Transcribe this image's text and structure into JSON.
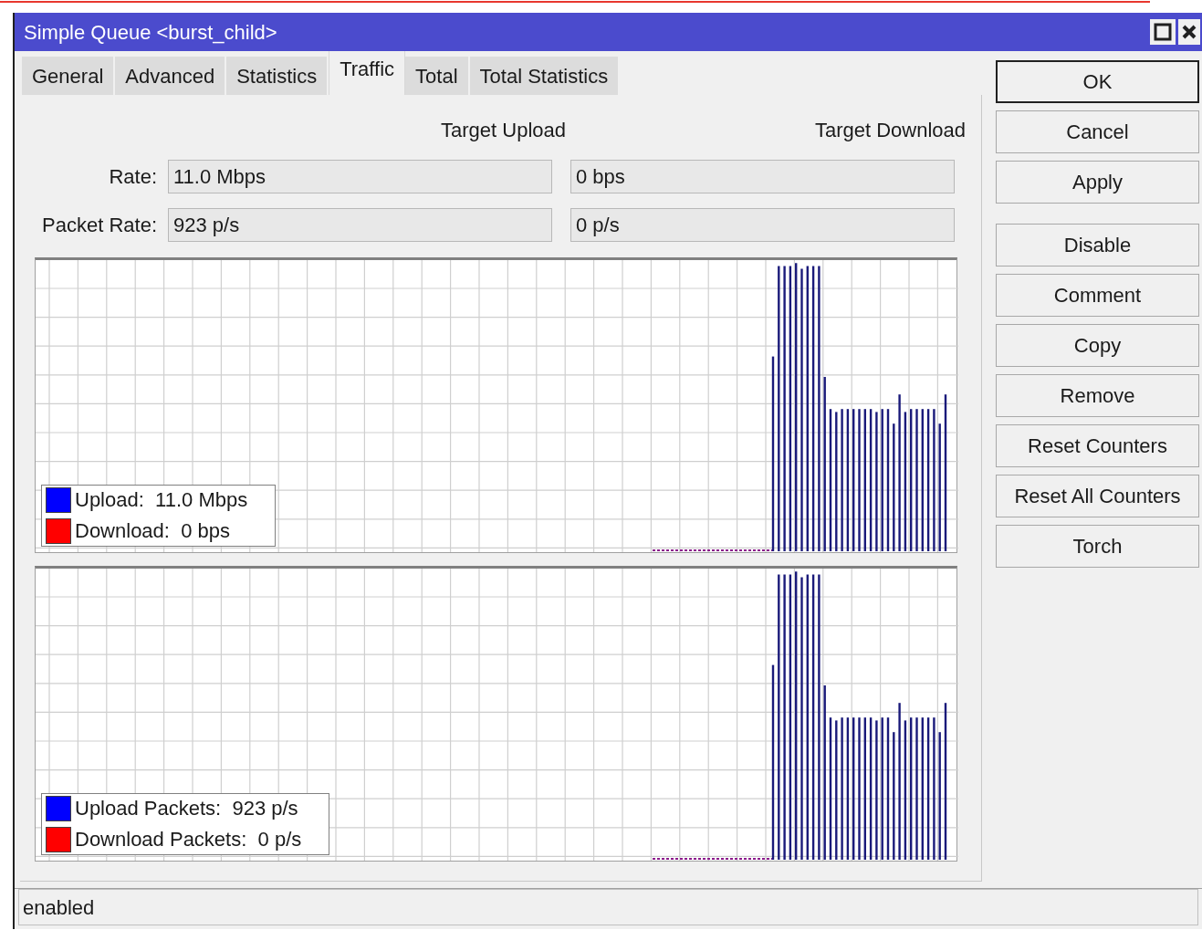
{
  "window": {
    "title": "Simple Queue <burst_child>"
  },
  "tabs": [
    {
      "label": "General",
      "selected": false
    },
    {
      "label": "Advanced",
      "selected": false
    },
    {
      "label": "Statistics",
      "selected": false
    },
    {
      "label": "Traffic",
      "selected": true
    },
    {
      "label": "Total",
      "selected": false
    },
    {
      "label": "Total Statistics",
      "selected": false
    }
  ],
  "columns": [
    "Target Upload",
    "Target Download"
  ],
  "rows": [
    {
      "label": "Rate:",
      "values": [
        "11.0 Mbps",
        "0 bps"
      ]
    },
    {
      "label": "Packet Rate:",
      "values": [
        "923 p/s",
        "0 p/s"
      ]
    }
  ],
  "graphs": [
    {
      "legend": [
        {
          "label": "Upload:",
          "value": "11.0 Mbps",
          "color": "#0000ff"
        },
        {
          "label": "Download:",
          "value": "0 bps",
          "color": "#ff0000"
        }
      ]
    },
    {
      "legend": [
        {
          "label": "Upload Packets:",
          "value": "923 p/s",
          "color": "#0000ff"
        },
        {
          "label": "Download Packets:",
          "value": "0 p/s",
          "color": "#ff0000"
        }
      ]
    }
  ],
  "buttons": [
    {
      "label": "OK",
      "default": true
    },
    {
      "label": "Cancel",
      "default": false
    },
    {
      "label": "Apply",
      "default": false
    },
    {
      "label": "Disable",
      "default": false
    },
    {
      "label": "Comment",
      "default": false
    },
    {
      "label": "Copy",
      "default": false
    },
    {
      "label": "Remove",
      "default": false
    },
    {
      "label": "Reset Counters",
      "default": false
    },
    {
      "label": "Reset All Counters",
      "default": false
    },
    {
      "label": "Torch",
      "default": false
    }
  ],
  "status_bar": {
    "text": "enabled"
  }
}
